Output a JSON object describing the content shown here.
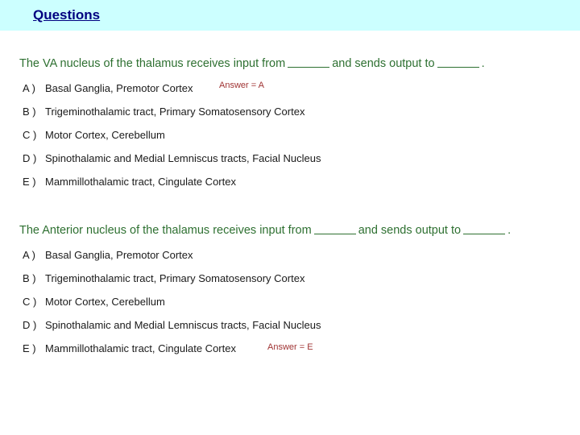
{
  "header": {
    "title": "Questions",
    "background_color": "#ccffff",
    "title_color": "#000080"
  },
  "colors": {
    "question_green": "#2e7031",
    "option_text": "#1a1a1a",
    "answer_red": "#a03434",
    "page_background": "#ffffff"
  },
  "questions": [
    {
      "stem_part1": "The VA nucleus of the thalamus receives input from",
      "stem_part2": "and sends output to",
      "stem_part3": ".",
      "options": [
        {
          "letter": "A )",
          "text": "Basal Ganglia, Premotor Cortex"
        },
        {
          "letter": "B )",
          "text": "Trigeminothalamic tract, Primary Somatosensory Cortex"
        },
        {
          "letter": "C )",
          "text": "Motor Cortex, Cerebellum"
        },
        {
          "letter": "D )",
          "text": "Spinothalamic and Medial Lemniscus tracts, Facial Nucleus"
        },
        {
          "letter": "E )",
          "text": "Mammillothalamic tract, Cingulate Cortex"
        }
      ],
      "answer_label": "Answer = A",
      "answer_on_option_index": 0
    },
    {
      "stem_part1": "The Anterior nucleus of the thalamus receives input from",
      "stem_part2": "and sends output to",
      "stem_part3": ".",
      "options": [
        {
          "letter": "A )",
          "text": "Basal Ganglia, Premotor Cortex"
        },
        {
          "letter": "B )",
          "text": "Trigeminothalamic tract, Primary Somatosensory Cortex"
        },
        {
          "letter": "C )",
          "text": "Motor Cortex, Cerebellum"
        },
        {
          "letter": "D )",
          "text": "Spinothalamic and Medial Lemniscus tracts, Facial Nucleus"
        },
        {
          "letter": "E )",
          "text": "Mammillothalamic tract, Cingulate Cortex"
        }
      ],
      "answer_label": "Answer = E",
      "answer_on_option_index": 4
    }
  ]
}
